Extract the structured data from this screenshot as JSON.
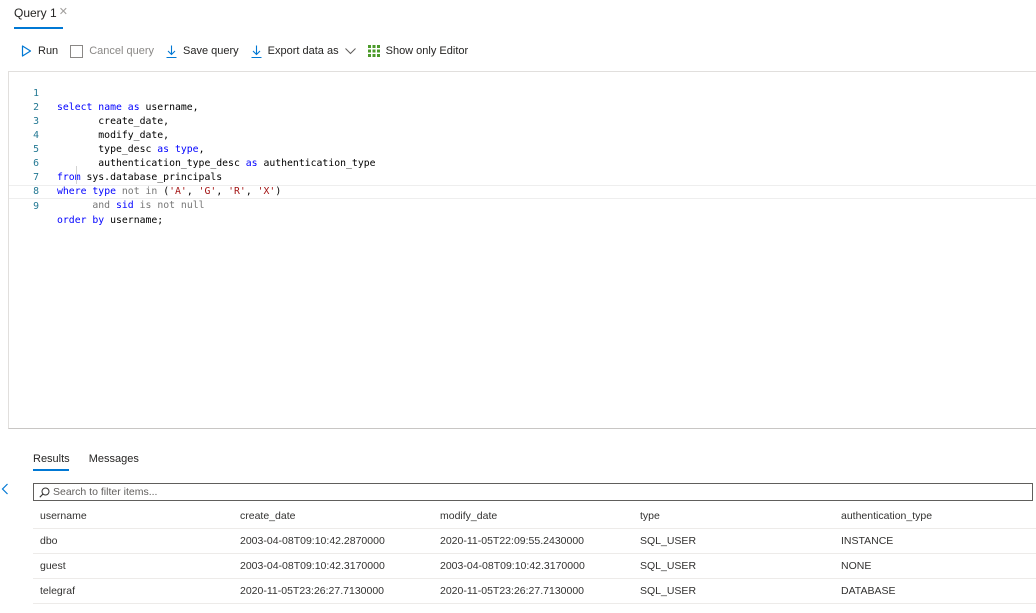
{
  "tabs": [
    {
      "label": "Query 1",
      "close": "✕"
    }
  ],
  "toolbar": {
    "run_label": "Run",
    "cancel_label": "Cancel query",
    "save_label": "Save query",
    "export_label": "Export data as",
    "show_editor_label": "Show only Editor"
  },
  "editor": {
    "line_numbers": [
      "1",
      "2",
      "3",
      "4",
      "5",
      "6",
      "7",
      "8",
      "9"
    ],
    "lines": [
      "select name as username,",
      "       create_date,",
      "       modify_date,",
      "       type_desc as type,",
      "       authentication_type_desc as authentication_type",
      "from sys.database_principals",
      "where type not in ('A', 'G', 'R', 'X')",
      "      and sid is not null",
      "order by username;"
    ]
  },
  "results": {
    "tabs": [
      "Results",
      "Messages"
    ],
    "filter_placeholder": "Search to filter items...",
    "columns": [
      "username",
      "create_date",
      "modify_date",
      "type",
      "authentication_type"
    ],
    "rows": [
      [
        "dbo",
        "2003-04-08T09:10:42.2870000",
        "2020-11-05T22:09:55.2430000",
        "SQL_USER",
        "INSTANCE"
      ],
      [
        "guest",
        "2003-04-08T09:10:42.3170000",
        "2003-04-08T09:10:42.3170000",
        "SQL_USER",
        "NONE"
      ],
      [
        "telegraf",
        "2020-11-05T23:26:27.7130000",
        "2020-11-05T23:26:27.7130000",
        "SQL_USER",
        "DATABASE"
      ]
    ]
  },
  "colors": {
    "accent": "#0078d4",
    "keyword": "#0000ff",
    "string": "#a31515",
    "line_number": "#237893",
    "grid_icon": "#4c9a2a"
  }
}
